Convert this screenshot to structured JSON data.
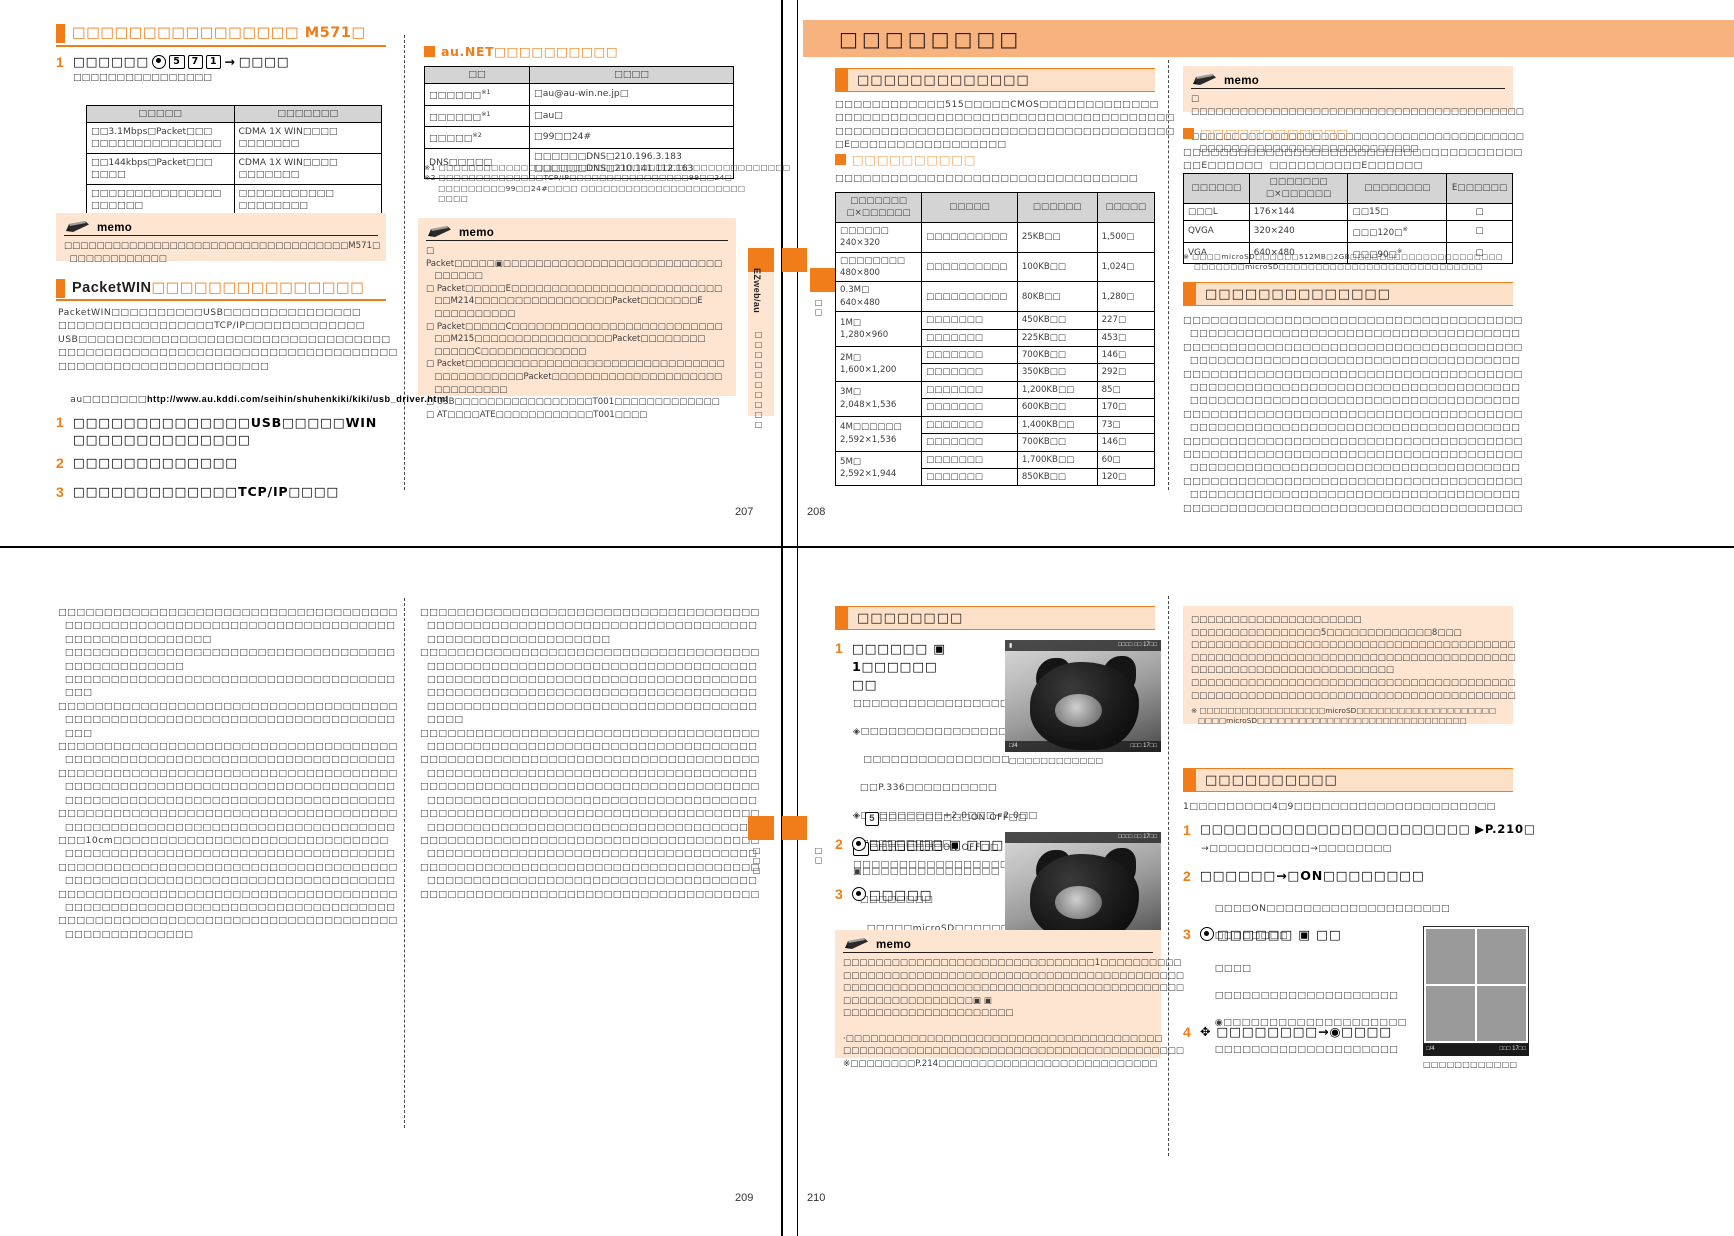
{
  "doc": {
    "kind": "japanese-mobile-phone-manual-scan",
    "tofu": "□"
  },
  "page207": {
    "number": "207",
    "heading": "□□□□□□□□□□□□□□□□ M571□",
    "step1": {
      "num": "1",
      "text_a": "□□□□□□",
      "keys": [
        "●",
        "5",
        "7",
        "1"
      ],
      "arrow": "→",
      "text_b": "□□□□",
      "sub": "□□□□□□□□□□□□□□□□"
    },
    "table1": {
      "headers": [
        "□□□□□",
        "□□□□□□□"
      ],
      "rows": [
        [
          "□□3.1Mbps□Packet□□□\n□□□□□□□□□□□□□□□",
          "CDMA 1X WIN□□□□\n□□□□□□□"
        ],
        [
          "□□144kbps□Packet□□□\n□□□□",
          "CDMA 1X WIN□□□□\n□□□□□□□"
        ],
        [
          "□□□□□□□□□□□□□□□\n□□□□□□",
          "□□□□□□□□□□□\n□□□□□□□□"
        ]
      ]
    },
    "memo1": {
      "label": "memo",
      "body": "□□□□□□□□□□□□□□□□□□□□□□□□□□□□□□□□□□□M571□\n  □□□□□□□□□□□□"
    },
    "sec2": {
      "heading_bold": "PacketWIN",
      "heading_rest": "□□□□□□□□□□□□□□□",
      "para": "PacketWIN□□□□□□□□□□USB□□□□□□□□□□□□□□□\n□□□□□□□□□□□□□□□□□TCP/IP□□□□□□□□□□□□□\nUSB□□□□□□□□□□□□□□□□□□□□□□□□□□□□□□□□□□\n□□□□□□□□□□□□□□□□□□□□□□□□□□□□□□□□□□□□□\n□□□□□□□□□□□□□□□□□□□□□□□",
      "url_label": "au□□□□□□□",
      "url": "http://www.au.kddi.com/seihin/shuhenkiki/kiki/usb_driver.html"
    },
    "steps2": [
      {
        "num": "1",
        "text": "□□□□□□□□□□□□□□USB□□□□□WIN\n□□□□□□□□□□□□□□"
      },
      {
        "num": "2",
        "text": "□□□□□□□□□□□□□"
      },
      {
        "num": "3",
        "text": "□□□□□□□□□□□□□TCP/IP□□□□"
      }
    ],
    "col2": {
      "sqhead": "au.NET□□□□□□□□□□",
      "table": {
        "headers": [
          "□□",
          "□□□□"
        ],
        "rows": [
          [
            "□□□□□□<sup>※1</sup>",
            "□au@au-win.ne.jp□"
          ],
          [
            "□□□□□□<sup>※1</sup>",
            "□au□"
          ],
          [
            "□□□□□<sup>※2</sup>",
            "□99□□24#"
          ],
          [
            "DNS□□□□□",
            "□□□□□□DNS□210.196.3.183\n□□□□□□DNS□210.141.112.163"
          ]
        ]
      },
      "footnotes": "※1 □□□□□□□□□□□□□□□□□□□□□□□□□□□□□□□□□□□□□□□□□□□□□□□\n※2 □□□□□□□□□□□□□□TCP/IP□□□□□□□□□□□□□□□□99□□24□\n     □□□□□□□□□99□□24#□□□□ □□□□□□□□□□□□□□□□□□□□□□\n     □□□□",
      "memo": {
        "label": "memo",
        "body": "□ Packet□□□□□▣□□□□□□□□□□□□□□□□□□□□□□□□□□□\n   □□□□□□\n□ Packet□□□□□E□□□□□□□□□□□□□□□□□□□□□□□□□□\n   □□M214□□□□□□□□□□□□□□□□□Packet□□□□□□□E\n   □□□□□□□□□□\n□ Packet□□□□□C□□□□□□□□□□□□□□□□□□□□□□□□□□\n   □□M215□□□□□□□□□□□□□□□□□Packet□□□□□□□□\n   □□□□□C□□□□□□□□□□□□□\n□ Packet□□□□□□□□□□□□□□□□□□□□□□□□□□□□□□□□\n   □□□□□□□□□□□Packet□□□□□□□□□□□□□□□□□□□□□\n   □□□□□□□□□\n□ USB□□□□□□□□□□□□□□□□□T001□□□□□□□□□□□□□\n□ AT□□□□ATE□□□□□□□□□□□□T001□□□□"
      },
      "sidetab": "EZweb/au"
    }
  },
  "page208": {
    "number": "208",
    "banner": "□□□□□□□□",
    "sec1": {
      "barhead": "□□□□□□□□□□□□□",
      "para": "□□□□□□□□□□□□515□□□□□CMOS□□□□□□□□□□□□□\n□□□□□□□□□□□□□□□□□□□□□□□□□□□□□□□□□□□□□\n□□□□□□□□□□□□□□□□□□□□□□□□□□□□□□□□□□□□□\n□E□□□□□□□□□□□□□□□□□"
    },
    "sqhead1": "□□□□□□□□□□",
    "sub1": "□□□□□□□□□□□□□□□□□□□□□□□□□□□□□□□□□",
    "photo_table": {
      "headers": [
        "□□□□□□□\n□×□□□□□□",
        "□□□□□",
        "□□□□□□",
        "□□□□□"
      ],
      "rows": [
        [
          "□□□□□□\n240×320",
          "□□□□□□□□□□",
          "25KB□□",
          "1,500□"
        ],
        [
          "□□□□□□□□\n480×800",
          "□□□□□□□□□□",
          "100KB□□",
          "1,024□"
        ],
        [
          "0.3M□\n640×480",
          "□□□□□□□□□□",
          "80KB□□",
          "1,280□"
        ],
        [
          "1M□\n1,280×960",
          "□□□□□□□",
          "450KB□□",
          "227□"
        ],
        [
          "",
          "□□□□□□□",
          "225KB□□",
          "453□"
        ],
        [
          "2M□\n1,600×1,200",
          "□□□□□□□",
          "700KB□□",
          "146□"
        ],
        [
          "",
          "□□□□□□□",
          "350KB□□",
          "292□"
        ],
        [
          "3M□\n2,048×1,536",
          "□□□□□□□",
          "1,200KB□□",
          "85□"
        ],
        [
          "",
          "□□□□□□□",
          "600KB□□",
          "170□"
        ],
        [
          "4M□□□□□□\n2,592×1,536",
          "□□□□□□□",
          "1,400KB□□",
          "73□"
        ],
        [
          "",
          "□□□□□□□",
          "700KB□□",
          "146□"
        ],
        [
          "5M□\n2,592×1,944",
          "□□□□□□□",
          "1,700KB□□",
          "60□"
        ],
        [
          "",
          "□□□□□□□",
          "850KB□□",
          "120□"
        ]
      ]
    },
    "col2": {
      "memo": {
        "label": "memo",
        "body": "□ □□□□□□□□□□□□□□□□□□□□□□□□□□□□□□□□□□□□□□□□□\n   □□□□□□□□□□□□□□□□□□□□□□□□□□□□□□□□□□□□□□□□□\n   □□□□□□□□□□□□□□□□□□□□□□□□□□□"
      },
      "sqhead": "□□□□□□□□□□□□",
      "sub": "□□□□□□□□□□□□□□□□□□□□□□□□□□□□□□□□□□□□□\n□□E□□□□□□  □□□□□□□□□□E□□□□□□",
      "video_table": {
        "headers": [
          "□□□□□□",
          "□□□□□□□\n□×□□□□□□",
          "□□□□□□□□",
          "E□□□□□□"
        ],
        "rows": [
          [
            "□□□L",
            "176×144",
            "□□15□",
            "□"
          ],
          [
            "QVGA",
            "320×240",
            "□□□120□<sup>※</sup>",
            "□"
          ],
          [
            "VGA",
            "640×480",
            "□□□90□<sup>※</sup>",
            "□"
          ]
        ]
      },
      "footnote": "※ □□□□microSD□□□□□□512MB□2GB□□□□□□□□□□□□□□□□□□□□□\n    □□□□□□□microSD□□□□□□□□□□□□□□□□□□□□□□□□□□□□",
      "barhead2": "□□□□□□□□□□□□□□",
      "body": "□□□□□□□□□□□□□□□□□□□□□□□□□□□□□□□□□□□□□\n  □□□□□□□□□□□□□□□□□□□□□□□□□□□□□□□□□□□□\n□□□□□□□□□□□□□□□□□□□□□□□□□□□□□□□□□□□□□\n  □□□□□□□□□□□□□□□□□□□□□□□□□□□□□□□□□□□□\n□□□□□□□□□□□□□□□□□□□□□□□□□□□□□□□□□□□□□\n  □□□□□□□□□□□□□□□□□□□□□□□□□□□□□□□□□□□□\n  □□□□□□□□□□□□□□□□□□□□□□□□□□□□□□□□□□□□\n□□□□□□□□□□□□□□□□□□□□□□□□□□□□□□□□□□□□□\n  □□□□□□□□□□□□□□□□□□□□□□□□□□□□□□□□□□□□\n□□□□□□□□□□□□□□□□□□□□□□□□□□□□□□□□□□□□□\n□□□□□□□□□□□□□□□□□□□□□□□□□□□□□□□□□□□□□\n  □□□□□□□□□□□□□□□□□□□□□□□□□□□□□□□□□□□□\n□□□□□□□□□□□□□□□□□□□□□□□□□□□□□□□□□□□□□\n  □□□□□□□□□□□□□□□□□□□□□□□□□□□□□□□□□□□□\n□□□□□□□□□□□□□□□□□□□□□□□□□□□□□□□□□□□□□"
    }
  },
  "page209": {
    "number": "209",
    "col1": "□□□□□□□□□□□□□□□□□□□□□□□□□□□□□□□□□□□□□\n  □□□□□□□□□□□□□□□□□□□□□□□□□□□□□□□□□□□□\n  □□□□□□□□□□□□□□□□\n  □□□□□□□□□□□□□□□□□□□□□□□□□□□□□□□□□□□□\n  □□□□□□□□□□□□□\n  □□□□□□□□□□□□□□□□□□□□□□□□□□□□□□□□□□□□\n  □□□\n□□□□□□□□□□□□□□□□□□□□□□□□□□□□□□□□□□□□□\n  □□□□□□□□□□□□□□□□□□□□□□□□□□□□□□□□□□□□\n  □□□\n□□□□□□□□□□□□□□□□□□□□□□□□□□□□□□□□□□□□□\n  □□□□□□□□□□□□□□□□□□□□□□□□□□□□□□□□□□□□\n□□□□□□□□□□□□□□□□□□□□□□□□□□□□□□□□□□□□□\n  □□□□□□□□□□□□□□□□□□□□□□□□□□□□□□□□□□□□\n  □□□□□□□□□□□□□□□□□□□□□□□□□□□□□□□□□□□□\n□□□□□□□□□□□□□□□□□□□□□□□□□□□□□□□□□□□□□\n  □□□□□□□□□□□□□□□□□□□□□□□□□□□□□□□□□□□□\n□□□10cm□□□□□□□□□□□□□□□□□□□□□□□□□□□□□□\n  □□□□□□□□□□□□□□□□□□□□□□□□□□□□□□□□□□□□\n□□□□□□□□□□□□□□□□□□□□□□□□□□□□□□□□□□□□□\n  □□□□□□□□□□□□□□□□□□□□□□□□□□□□□□□□□□□□\n□□□□□□□□□□□□□□□□□□□□□□□□□□□□□□□□□□□□□\n  □□□□□□□□□□□□□□□□□□□□□□□□□□□□□□□□□□□□\n□□□□□□□□□□□□□□□□□□□□□□□□□□□□□□□□□□□□□\n  □□□□□□□□□□□□□□",
    "col2": "□□□□□□□□□□□□□□□□□□□□□□□□□□□□□□□□□□□□□\n  □□□□□□□□□□□□□□□□□□□□□□□□□□□□□□□□□□□□\n  □□□□□□□□□□□□□□□□□□□□\n□□□□□□□□□□□□□□□□□□□□□□□□□□□□□□□□□□□□□\n  □□□□□□□□□□□□□□□□□□□□□□□□□□□□□□□□□□□□\n  □□□□□□□□□□□□□□□□□□□□□□□□□□□□□□□□□□□□\n  □□□□□□□□□□□□□□□□□□□□□□□□□□□□□□□□□□□□\n  □□□□□□□□□□□□□□□□□□□□□□□□□□□□□□□□□□□□\n  □□□□\n□□□□□□□□□□□□□□□□□□□□□□□□□□□□□□□□□□□□□\n  □□□□□□□□□□□□□□□□□□□□□□□□□□□□□□□□□□□□\n□□□□□□□□□□□□□□□□□□□□□□□□□□□□□□□□□□□□□\n  □□□□□□□□□□□□□□□□□□□□□□□□□□□□□□□□□□□□\n□□□□□□□□□□□□□□□□□□□□□□□□□□□□□□□□□□□□□\n  □□□□□□□□□□□□□□□□□□□□□□□□□□□□□□□□□□□□\n□□□□□□□□□□□□□□□□□□□□□□□□□□□□□□□□□□□□□\n  □□□□□□□□□□□□□□□□□□□□□□□□□□□□□□□□□□□□\n□□□□□□□□□□□□□□□□□□□□□□□□□□□□□□□□□□□□□\n  □□□□□□□□□□□□□□□□□□□□□□□□□□□□□□□□□□□□\n□□□□□□□□□□□□□□□□□□□□□□□□□□□□□□□□□□□□□\n  □□□□□□□□□□□□□□□□□□□□□□□□□□□□□□□□□□□□\n□□□□□□□□□□□□□□□□□□□□□□□□□□□□□□□□□□□□□",
    "sidelabel": "□□□"
  },
  "page210": {
    "number": "210",
    "barhead": "□□□□□□□□",
    "steps": [
      {
        "num": "1",
        "text": "□□□□□□ ▣ 1□□□□□□\n□□",
        "lines": [
          "□□□□□□□□□□□□□□□□□□",
          "◈□□□□□□□□□□□□□□□□□",
          "   □□□□□□□□□□□□□□□□",
          "  □□P.336□□□□□□□□□□",
          "◈□□□□□□□□□+2.0□□□−2.0□□",
          "  □□□□□□□□□□",
          "▣□□□□□□□□□□□□□□□",
          "  □□□□□□□□",
          "5□□□□□□□□□□ON OFF□□",
          "□□□□□□□□□□ON OFF□□"
        ]
      },
      {
        "num": "2",
        "text": "□□□□□□ ▣ □□□□",
        "lines": [
          "□□□□□□□□□□□□□□□□□"
        ]
      },
      {
        "num": "3",
        "text": "□□□□□",
        "lines": [
          "□□□□□microSD□□□□□□□□□",
          "□□□□□□□□□□□□□□□□□"
        ]
      }
    ],
    "memo": {
      "label": "memo",
      "body": "□□□□□□□□□□□□□□□□□□□□□□□□□□□□□□□1□□□□□□□□□□\n□□□□□□□□□□□□□□□□□□□□□□□□□□□□□□□□□□□□□□□□□□\n□□□□□□□□□□□□□□□□□□□□□□□□□□□□□□□□□□□□□□□□□□\n□□□□□□□□□□□□□□□□▣ ▣ □□□□□□□□□□□□□□□□□□□□□\n  ·□□□□□□□□□□□□□□□□□□□□□□□□□□□□□□□□□□□□□□□\n□□□□□□□□□□□□□□□□□□□□□□□□□□□□□□□□□□□□□□□□□□\n※□□□□□□□□P.214□□□□□□□□□□□□□□□□□□□□□□□□□□□"
    },
    "caption1": "□□□□□□□□□□□□",
    "caption2": "□□□□□□□□□□□□",
    "caption3": "□□□□□□□□□□□",
    "col2": {
      "notebox": "□□□□□□□□□□□□□□□□□□□□□\n□□□□□□□□□□□□□□□□5□□□□□□□□□□□□□8□□□\n□□□□□□□□□□□□□□□□□□□□□□□□□□□□□□□□□□□□□□□□\n□□□□□□□□□□□□□□□□□□□□□□□□□□□□□□□□□□□□□□□□\n□□□□□□□□□□□□□□□□□□□□□□□□□\n□□□□□□□□□□□□□□□□□□□□□□□□□□□□□□□□□□□□□□□□\n□□□□□□□□□□□□□□□□□□□□□□□□□□□□□□□□□□□□□□□□",
      "notebox_fn": "※ □□□□□□□□□□□□□□□□□□microSD□□□□□□□□□□□□□□□□□□□□\n   □□□□microSD□□□□□□□□□□□□□□□□□□□□□□□□□□□□□□",
      "barhead": "□□□□□□□□□□",
      "intro": "1□□□□□□□□□4□9□□□□□□□□□□□□□□□□□□□□□□",
      "steps": [
        {
          "num": "1",
          "text": "□□□□□□□□□□□□□□□□□□□□□□□ ▶P.210□",
          "lines": [
            "→□□□□□□□□□□□→□□□□□□□□"
          ]
        },
        {
          "num": "2",
          "text": "□□□□□□→□ON□□□□□□□□",
          "lines": [
            "□□□□ON□□□□□□□□□□□□□□□□□□□□",
            "□□□□□□□□"
          ]
        },
        {
          "num": "3",
          "text": "□□□□□□ ▣ □□",
          "lines": [
            "□□□□",
            "□□□□□□□□□□□□□□□□□□□□",
            "◉□□□□□□□□□□□□□□□□□□□□",
            "□□□□□□□□□□□□□□□□□□□□"
          ]
        },
        {
          "num": "4",
          "text": "✥ □□□□□□□□→◉□□□□",
          "lines": []
        }
      ],
      "grid_caption": "□□□□□□□□□□□□"
    }
  }
}
